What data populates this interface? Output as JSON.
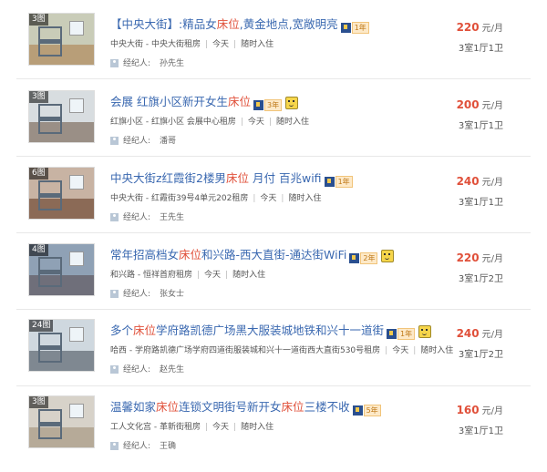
{
  "colors": {
    "title": "#3a68b0",
    "highlight": "#e0503a",
    "price": "#e0503a"
  },
  "listings": [
    {
      "badge": "3图",
      "title_parts": [
        {
          "text": "【中央大街】:精品女",
          "hl": false
        },
        {
          "text": "床位",
          "hl": true
        },
        {
          "text": ",黄金地点,宽敞明亮",
          "hl": false
        }
      ],
      "vip_years": "1年",
      "smile": false,
      "meta": [
        "中央大街 - 中央大街租房",
        "今天",
        "随时入住"
      ],
      "agent_label": "经纪人:",
      "agent": "孙先生",
      "price": "220",
      "price_unit": "元/月",
      "layout": "3室1厅1卫"
    },
    {
      "badge": "3图",
      "title_parts": [
        {
          "text": "会展 红旗小区新开女生",
          "hl": false
        },
        {
          "text": "床位",
          "hl": true
        }
      ],
      "vip_years": "3年",
      "smile": true,
      "meta": [
        "红旗小区 - 红旗小区 会展中心租房",
        "今天",
        "随时入住"
      ],
      "agent_label": "经纪人:",
      "agent": "潘哥",
      "price": "200",
      "price_unit": "元/月",
      "layout": "3室1厅1卫"
    },
    {
      "badge": "6图",
      "title_parts": [
        {
          "text": "中央大街z红霞街2楼男",
          "hl": false
        },
        {
          "text": "床位",
          "hl": true
        },
        {
          "text": " 月付 百兆wifi",
          "hl": false
        }
      ],
      "vip_years": "1年",
      "smile": false,
      "meta": [
        "中央大街 - 红霞街39号4单元202租房",
        "今天",
        "随时入住"
      ],
      "agent_label": "经纪人:",
      "agent": "王先生",
      "price": "240",
      "price_unit": "元/月",
      "layout": "3室1厅1卫"
    },
    {
      "badge": "4图",
      "title_parts": [
        {
          "text": "常年招高档女",
          "hl": false
        },
        {
          "text": "床位",
          "hl": true
        },
        {
          "text": "和兴路-西大直街-通达街WiFi",
          "hl": false
        }
      ],
      "vip_years": "2年",
      "smile": true,
      "meta": [
        "和兴路 - 恒祥首府租房",
        "今天",
        "随时入住"
      ],
      "agent_label": "经纪人:",
      "agent": "张女士",
      "price": "220",
      "price_unit": "元/月",
      "layout": "3室1厅2卫"
    },
    {
      "badge": "24图",
      "title_parts": [
        {
          "text": "多个",
          "hl": false
        },
        {
          "text": "床位",
          "hl": true
        },
        {
          "text": "学府路凯德广场黑大服装城地铁和兴十一道街",
          "hl": false
        }
      ],
      "vip_years": "1年",
      "smile": true,
      "meta": [
        "哈西 - 学府路凯德广场学府四道街服装城和兴十一道街西大直街530号租房",
        "今天",
        "随时入住"
      ],
      "agent_label": "经纪人:",
      "agent": "赵先生",
      "price": "240",
      "price_unit": "元/月",
      "layout": "3室1厅2卫"
    },
    {
      "badge": "3图",
      "title_parts": [
        {
          "text": "温馨如家",
          "hl": false
        },
        {
          "text": "床位",
          "hl": true
        },
        {
          "text": "连锁文明街号新开女",
          "hl": false
        },
        {
          "text": "床位",
          "hl": true
        },
        {
          "text": "三楼不收",
          "hl": false
        }
      ],
      "vip_years": "5年",
      "smile": false,
      "meta": [
        "工人文化宫 - 革新街租房",
        "今天",
        "随时入住"
      ],
      "agent_label": "经纪人:",
      "agent": "王确",
      "price": "160",
      "price_unit": "元/月",
      "layout": "3室1厅1卫"
    }
  ]
}
